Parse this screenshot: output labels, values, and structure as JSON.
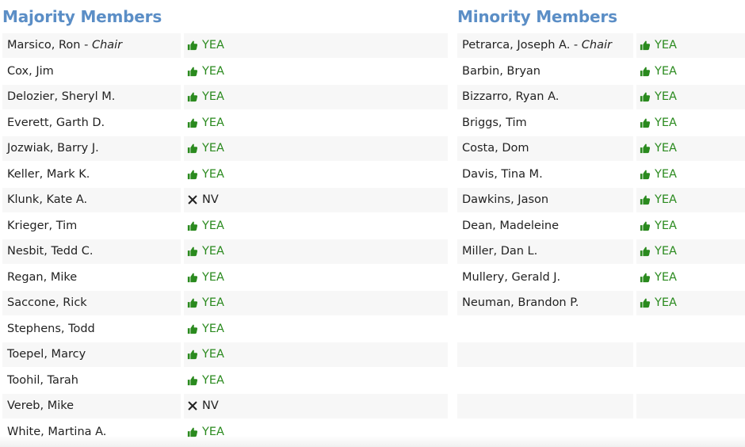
{
  "majority": {
    "title": "Majority Members",
    "members": [
      {
        "name": "Marsico, Ron",
        "role": "Chair",
        "vote": "YEA",
        "icon": "thumbs-up-icon"
      },
      {
        "name": "Cox, Jim",
        "vote": "YEA",
        "icon": "thumbs-up-icon"
      },
      {
        "name": "Delozier, Sheryl M.",
        "vote": "YEA",
        "icon": "thumbs-up-icon"
      },
      {
        "name": "Everett, Garth D.",
        "vote": "YEA",
        "icon": "thumbs-up-icon"
      },
      {
        "name": "Jozwiak, Barry J.",
        "vote": "YEA",
        "icon": "thumbs-up-icon"
      },
      {
        "name": "Keller, Mark K.",
        "vote": "YEA",
        "icon": "thumbs-up-icon"
      },
      {
        "name": "Klunk, Kate A.",
        "vote": "NV",
        "icon": "x-mark-icon"
      },
      {
        "name": "Krieger, Tim",
        "vote": "YEA",
        "icon": "thumbs-up-icon"
      },
      {
        "name": "Nesbit, Tedd C.",
        "vote": "YEA",
        "icon": "thumbs-up-icon"
      },
      {
        "name": "Regan, Mike",
        "vote": "YEA",
        "icon": "thumbs-up-icon"
      },
      {
        "name": "Saccone, Rick",
        "vote": "YEA",
        "icon": "thumbs-up-icon"
      },
      {
        "name": "Stephens, Todd",
        "vote": "YEA",
        "icon": "thumbs-up-icon"
      },
      {
        "name": "Toepel, Marcy",
        "vote": "YEA",
        "icon": "thumbs-up-icon"
      },
      {
        "name": "Toohil, Tarah",
        "vote": "YEA",
        "icon": "thumbs-up-icon"
      },
      {
        "name": "Vereb, Mike",
        "vote": "NV",
        "icon": "x-mark-icon"
      },
      {
        "name": "White, Martina A.",
        "vote": "YEA",
        "icon": "thumbs-up-icon"
      }
    ]
  },
  "minority": {
    "title": "Minority Members",
    "members": [
      {
        "name": "Petrarca, Joseph A.",
        "role": "Chair",
        "vote": "YEA",
        "icon": "thumbs-up-icon"
      },
      {
        "name": "Barbin, Bryan",
        "vote": "YEA",
        "icon": "thumbs-up-icon"
      },
      {
        "name": "Bizzarro, Ryan A.",
        "vote": "YEA",
        "icon": "thumbs-up-icon"
      },
      {
        "name": "Briggs, Tim",
        "vote": "YEA",
        "icon": "thumbs-up-icon"
      },
      {
        "name": "Costa, Dom",
        "vote": "YEA",
        "icon": "thumbs-up-icon"
      },
      {
        "name": "Davis, Tina M.",
        "vote": "YEA",
        "icon": "thumbs-up-icon"
      },
      {
        "name": "Dawkins, Jason",
        "vote": "YEA",
        "icon": "thumbs-up-icon"
      },
      {
        "name": "Dean, Madeleine",
        "vote": "YEA",
        "icon": "thumbs-up-icon"
      },
      {
        "name": "Miller, Dan L.",
        "vote": "YEA",
        "icon": "thumbs-up-icon"
      },
      {
        "name": "Mullery, Gerald J.",
        "vote": "YEA",
        "icon": "thumbs-up-icon"
      },
      {
        "name": "Neuman, Brandon P.",
        "vote": "YEA",
        "icon": "thumbs-up-icon"
      }
    ],
    "empty_rows": 4
  },
  "colors": {
    "title": "#5b8ec6",
    "yea": "#2a8a1e",
    "nv": "#222222",
    "row_stripe": "#f7f7f7"
  }
}
